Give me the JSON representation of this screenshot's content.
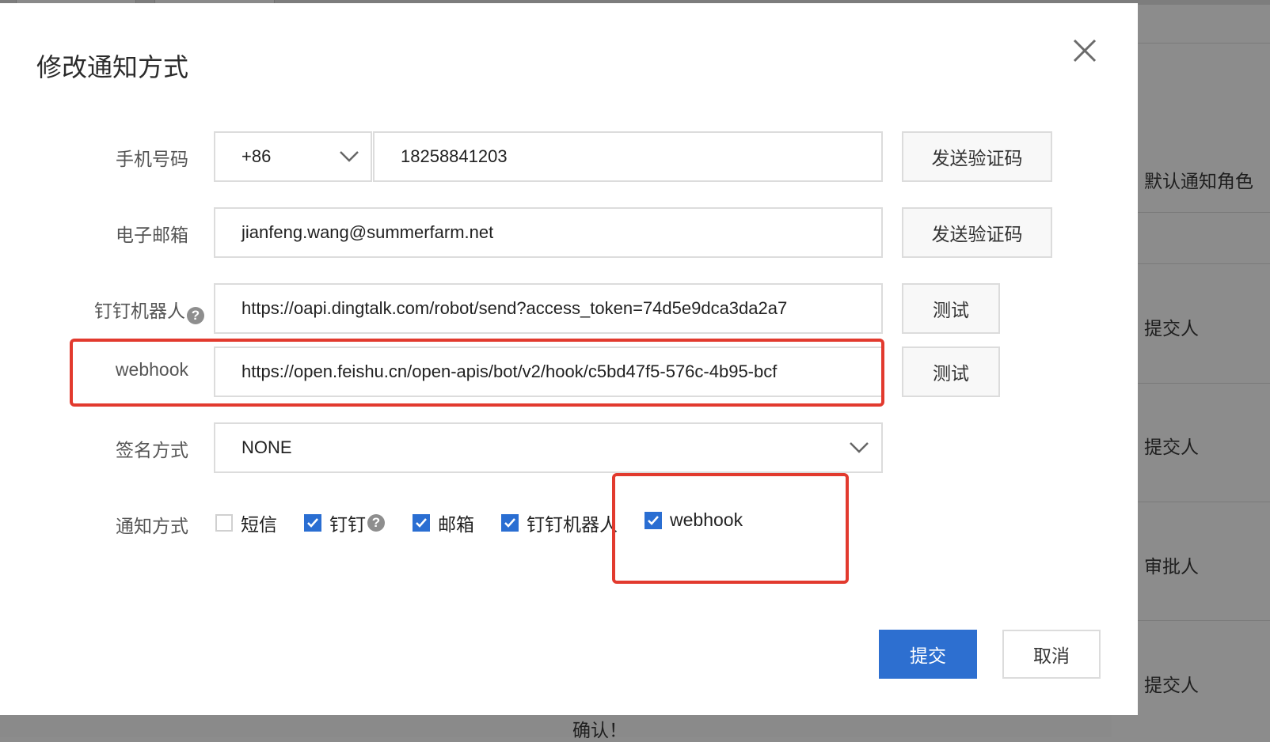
{
  "background": {
    "rows": [
      "默认通知角色",
      "提交人",
      "提交人",
      "审批人",
      "提交人"
    ],
    "footer_text": "确认！"
  },
  "modal": {
    "title": "修改通知方式",
    "close_icon": "close-icon",
    "phone": {
      "label": "手机号码",
      "country_code": "+86",
      "number": "18258841203",
      "send_code": "发送验证码"
    },
    "email": {
      "label": "电子邮箱",
      "value": "jianfeng.wang@summerfarm.net",
      "send_code": "发送验证码"
    },
    "dingtalk_robot": {
      "label": "钉钉机器人",
      "value": "https://oapi.dingtalk.com/robot/send?access_token=74d5e9dca3da2a7",
      "test": "测试"
    },
    "webhook": {
      "label": "webhook",
      "value": "https://open.feishu.cn/open-apis/bot/v2/hook/c5bd47f5-576c-4b95-bcf",
      "test": "测试"
    },
    "sign_method": {
      "label": "签名方式",
      "value": "NONE"
    },
    "notify_methods": {
      "label": "通知方式",
      "options": [
        {
          "label": "短信",
          "checked": false
        },
        {
          "label": "钉钉",
          "checked": true
        },
        {
          "label": "邮箱",
          "checked": true
        },
        {
          "label": "钉钉机器人",
          "checked": true
        },
        {
          "label": "webhook",
          "checked": true
        }
      ]
    },
    "submit": "提交",
    "cancel": "取消"
  },
  "colors": {
    "primary": "#2d6fd0",
    "highlight": "#e23a2e",
    "overlay": "#8c8c8c"
  }
}
